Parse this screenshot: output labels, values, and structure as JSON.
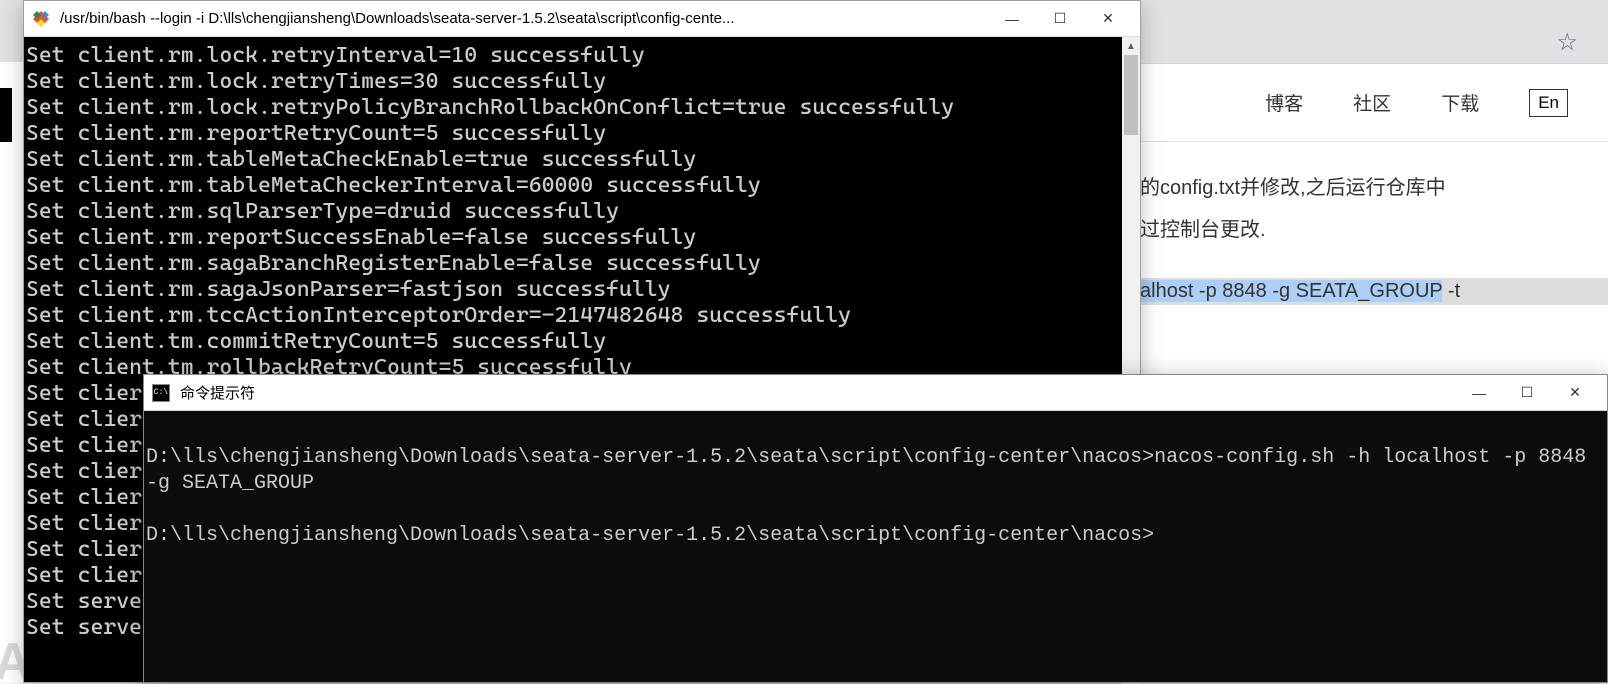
{
  "browser": {
    "nav": {
      "blog": "博客",
      "community": "社区",
      "download": "下载",
      "lang": "En"
    },
    "star_icon": "☆",
    "content": {
      "line1": "的config.txt并修改,之后运行仓库中",
      "line2": "过控制台更改.",
      "cmd_pre": "alhost -p 8848 -g SEATA_GROUP",
      "cmd_tail": " -t"
    }
  },
  "bash": {
    "title": "/usr/bin/bash --login -i D:\\lls\\chengjiansheng\\Downloads\\seata-server-1.5.2\\seata\\script\\config-cente...",
    "lines": [
      "Set client.rm.lock.retryInterval=10 successfully",
      "Set client.rm.lock.retryTimes=30 successfully",
      "Set client.rm.lock.retryPolicyBranchRollbackOnConflict=true successfully",
      "Set client.rm.reportRetryCount=5 successfully",
      "Set client.rm.tableMetaCheckEnable=true successfully",
      "Set client.rm.tableMetaCheckerInterval=60000 successfully",
      "Set client.rm.sqlParserType=druid successfully",
      "Set client.rm.reportSuccessEnable=false successfully",
      "Set client.rm.sagaBranchRegisterEnable=false successfully",
      "Set client.rm.sagaJsonParser=fastjson successfully",
      "Set client.rm.tccActionInterceptorOrder=-2147482648 successfully",
      "Set client.tm.commitRetryCount=5 successfully",
      "Set client.tm.rollbackRetryCount=5 successfully",
      "Set clier",
      "Set clier",
      "Set clier",
      "Set clier",
      "Set clier",
      "Set clier",
      "Set clier",
      "Set clier",
      "Set serve",
      "Set serve"
    ]
  },
  "cmd": {
    "title": "命令提示符",
    "icon_text": "C:\\",
    "line1": "D:\\lls\\chengjiansheng\\Downloads\\seata-server-1.5.2\\seata\\script\\config-center\\nacos>nacos-config.sh -h localhost -p 8848 -g SEATA_GROUP",
    "blank": "",
    "line2": "D:\\lls\\chengjiansheng\\Downloads\\seata-server-1.5.2\\seata\\script\\config-center\\nacos>"
  },
  "win_controls": {
    "minimize": "—",
    "maximize": "☐",
    "close": "✕"
  },
  "watermark": "TA"
}
